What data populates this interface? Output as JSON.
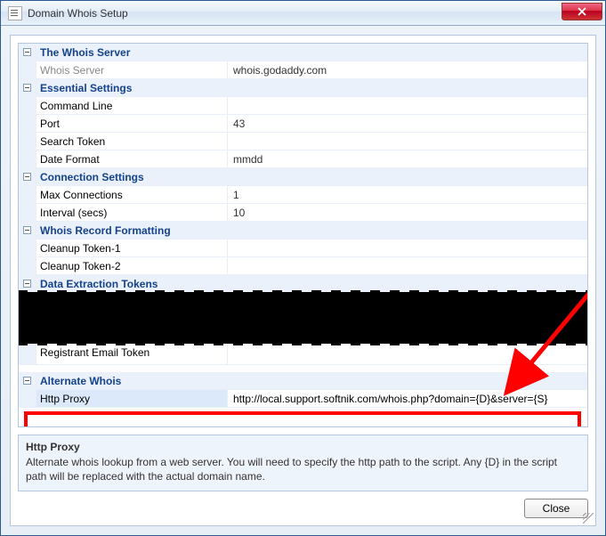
{
  "window": {
    "title": "Domain Whois Setup",
    "close_label": "Close"
  },
  "sections": {
    "whois_server": {
      "title": "The Whois Server",
      "rows": {
        "whois_server": {
          "label": "Whois Server",
          "value": "whois.godaddy.com"
        }
      }
    },
    "essential": {
      "title": "Essential Settings",
      "rows": {
        "command_line": {
          "label": "Command Line",
          "value": ""
        },
        "port": {
          "label": "Port",
          "value": "43"
        },
        "search_token": {
          "label": "Search Token",
          "value": ""
        },
        "date_format": {
          "label": "Date Format",
          "value": "mmdd"
        }
      }
    },
    "connection": {
      "title": "Connection Settings",
      "rows": {
        "max_conn": {
          "label": "Max Connections",
          "value": "1"
        },
        "interval": {
          "label": "Interval (secs)",
          "value": "10"
        }
      }
    },
    "formatting": {
      "title": "Whois Record Formatting",
      "rows": {
        "cleanup1": {
          "label": "Cleanup Token-1",
          "value": ""
        },
        "cleanup2": {
          "label": "Cleanup Token-2",
          "value": ""
        }
      }
    },
    "extraction": {
      "title": "Data Extraction Tokens",
      "rows": {
        "reg_email": {
          "label": "Registrant Email Token",
          "value": ""
        }
      }
    },
    "alternate": {
      "title": "Alternate Whois",
      "rows": {
        "http_proxy": {
          "label": "Http Proxy",
          "value": "http://local.support.softnik.com/whois.php?domain={D}&server={S}"
        }
      }
    }
  },
  "description": {
    "title": "Http Proxy",
    "text": "Alternate whois lookup from a web server. You will need to specify the http path to the script. Any {D} in the script path will be replaced with the actual domain name."
  }
}
